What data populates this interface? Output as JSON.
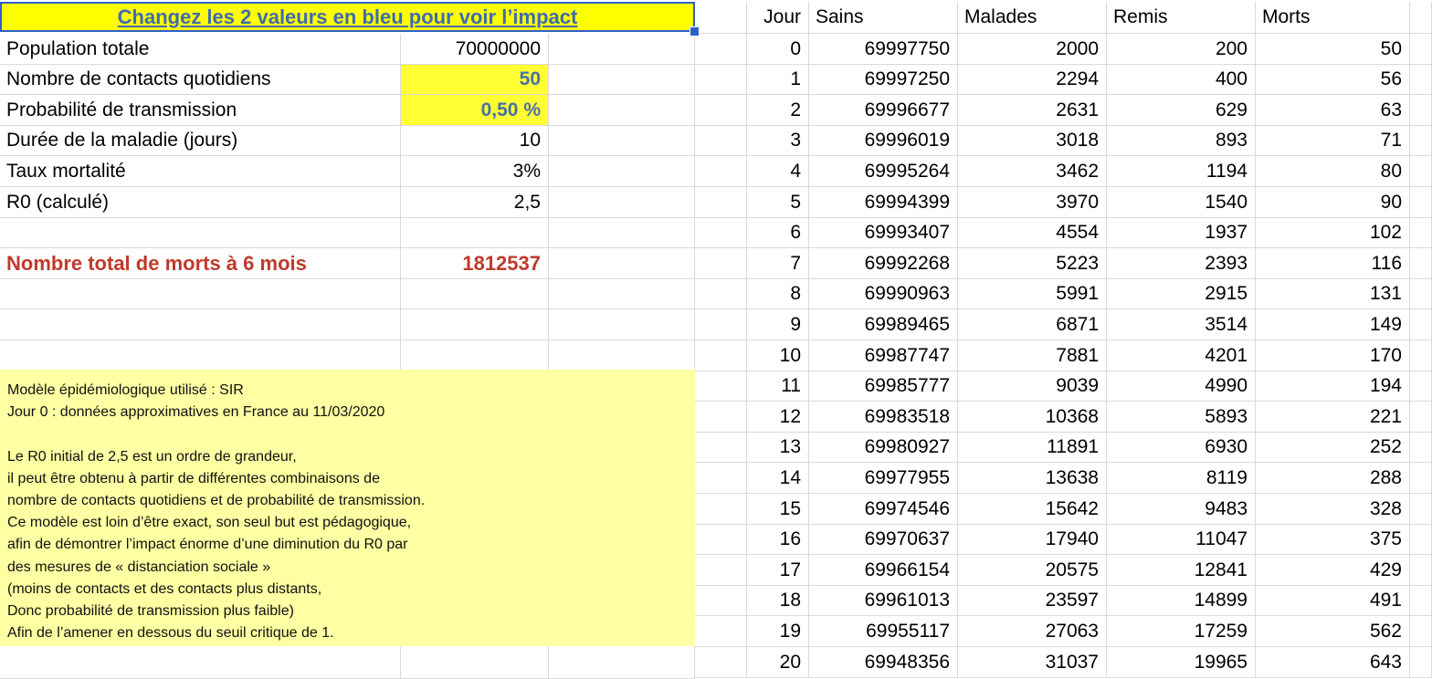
{
  "title": "Changez les 2 valeurs en bleu pour voir l’impact",
  "params": [
    {
      "label": "Population totale",
      "value": "70000000"
    },
    {
      "label": "Nombre de contacts quotidiens",
      "value": "50"
    },
    {
      "label": "Probabilité de transmission",
      "value": "0,50 %"
    },
    {
      "label": "Durée de la maladie (jours)",
      "value": "10"
    },
    {
      "label": "Taux mortalité",
      "value": "3%"
    },
    {
      "label": "R0 (calculé)",
      "value": "2,5"
    }
  ],
  "total": {
    "label": "Nombre total de morts à 6 mois",
    "value": "1812537"
  },
  "note": [
    "Modèle épidémiologique utilisé : SIR",
    "Jour 0 : données approximatives en France au 11/03/2020",
    "",
    "Le R0 initial de 2,5 est un ordre de grandeur,",
    "il peut être obtenu à partir de différentes combinaisons de",
    "nombre de contacts quotidiens et de probabilité de transmission.",
    "Ce modèle est loin d’être exact, son seul but est pédagogique,",
    "afin de démontrer l’impact énorme d’une diminution du R0 par",
    "des mesures de « distanciation sociale »",
    "(moins de contacts et des contacts plus distants,",
    "Donc probabilité de transmission plus faible)",
    "Afin de l’amener en dessous du seuil critique de 1."
  ],
  "table": {
    "headers": [
      "Jour",
      "Sains",
      "Malades",
      "Remis",
      "Morts"
    ],
    "rows": [
      [
        "0",
        "69997750",
        "2000",
        "200",
        "50"
      ],
      [
        "1",
        "69997250",
        "2294",
        "400",
        "56"
      ],
      [
        "2",
        "69996677",
        "2631",
        "629",
        "63"
      ],
      [
        "3",
        "69996019",
        "3018",
        "893",
        "71"
      ],
      [
        "4",
        "69995264",
        "3462",
        "1194",
        "80"
      ],
      [
        "5",
        "69994399",
        "3970",
        "1540",
        "90"
      ],
      [
        "6",
        "69993407",
        "4554",
        "1937",
        "102"
      ],
      [
        "7",
        "69992268",
        "5223",
        "2393",
        "116"
      ],
      [
        "8",
        "69990963",
        "5991",
        "2915",
        "131"
      ],
      [
        "9",
        "69989465",
        "6871",
        "3514",
        "149"
      ],
      [
        "10",
        "69987747",
        "7881",
        "4201",
        "170"
      ],
      [
        "11",
        "69985777",
        "9039",
        "4990",
        "194"
      ],
      [
        "12",
        "69983518",
        "10368",
        "5893",
        "221"
      ],
      [
        "13",
        "69980927",
        "11891",
        "6930",
        "252"
      ],
      [
        "14",
        "69977955",
        "13638",
        "8119",
        "288"
      ],
      [
        "15",
        "69974546",
        "15642",
        "9483",
        "328"
      ],
      [
        "16",
        "69970637",
        "17940",
        "11047",
        "375"
      ],
      [
        "17",
        "69966154",
        "20575",
        "12841",
        "429"
      ],
      [
        "18",
        "69961013",
        "23597",
        "14899",
        "491"
      ],
      [
        "19",
        "69955117",
        "27063",
        "17259",
        "562"
      ],
      [
        "20",
        "69948356",
        "31037",
        "19965",
        "643"
      ]
    ]
  }
}
